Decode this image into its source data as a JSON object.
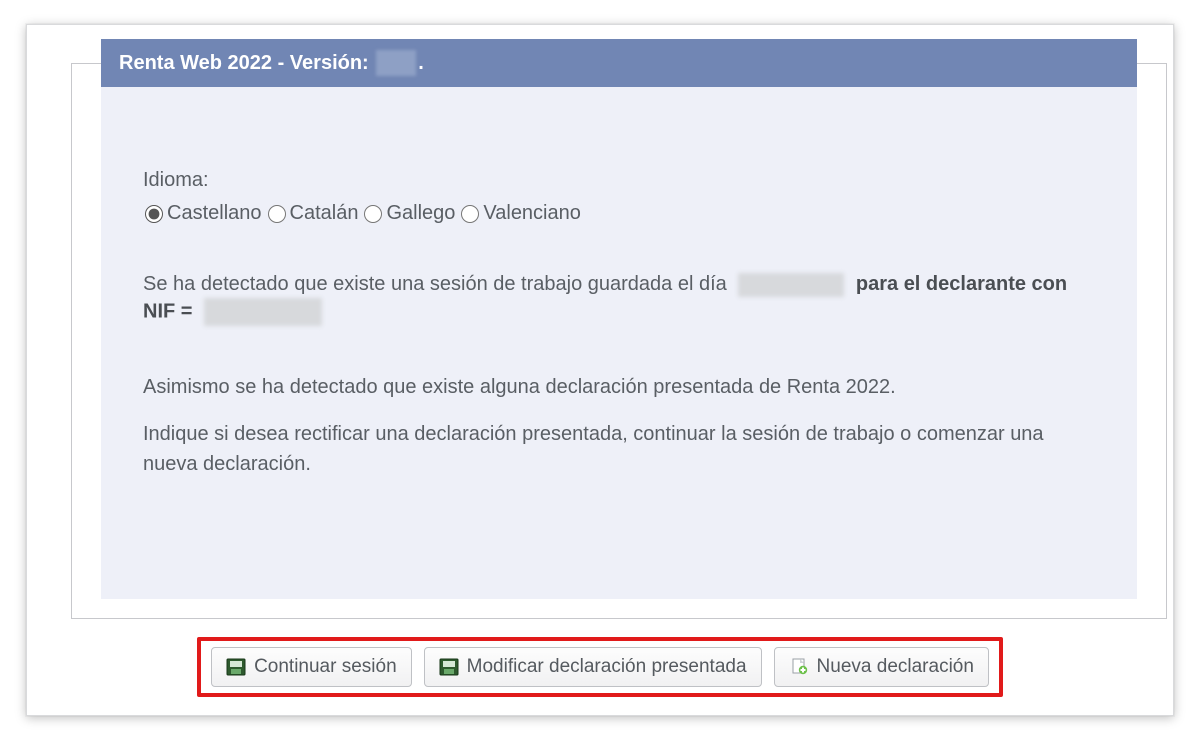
{
  "header": {
    "title_prefix": "Renta Web 2022 - Versión: ",
    "title_suffix": "."
  },
  "language": {
    "label": "Idioma:",
    "options": [
      "Castellano",
      "Catalán",
      "Gallego",
      "Valenciano"
    ],
    "selected": "Castellano"
  },
  "messages": {
    "session_prefix": "Se ha detectado que existe una sesión de trabajo guardada el día ",
    "session_bold_mid": " para el declarante con NIF = ",
    "presented": "Asimismo se ha detectado que existe alguna declaración presentada de Renta 2022.",
    "instruction": "Indique si desea rectificar una declaración presentada, continuar la sesión de trabajo o comenzar una nueva declaración."
  },
  "buttons": {
    "continue": "Continuar sesión",
    "modify": "Modificar declaración presentada",
    "new": "Nueva declaración"
  }
}
